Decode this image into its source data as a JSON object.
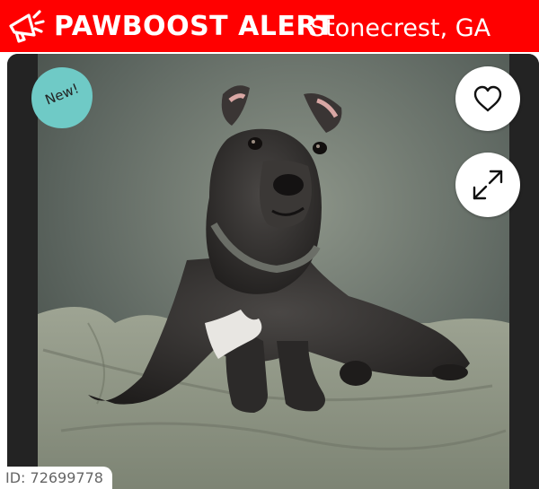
{
  "header": {
    "brand": "PAWBOOST ALERT",
    "location": "Stonecrest, GA",
    "background_color": "#ff0000",
    "icon": "megaphone-icon"
  },
  "photo": {
    "badge": "New!",
    "badge_color": "#6fcac6",
    "actions": [
      {
        "icon": "heart-icon"
      },
      {
        "icon": "expand-icon"
      }
    ]
  },
  "listing": {
    "id_text": "ID: 72699778"
  }
}
